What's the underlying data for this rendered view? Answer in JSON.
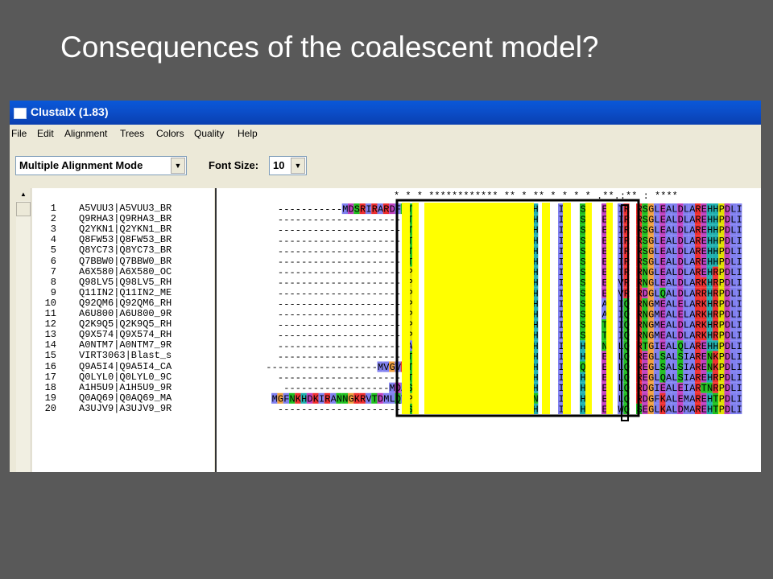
{
  "slide": {
    "title": "Consequences of the coalescent model?"
  },
  "window": {
    "title": "ClustalX (1.83)"
  },
  "menu": [
    "File",
    "Edit",
    "Alignment",
    "Trees",
    "Colors",
    "Quality",
    "Help"
  ],
  "toolbar": {
    "mode_value": "Multiple Alignment Mode",
    "font_size_label": "Font Size:",
    "font_size_value": "10"
  },
  "conservation_line": "* * * ************ ** * ** * * *  * .**.:** : ****",
  "sequences": [
    {
      "num": "1",
      "name": "A5VUU3|A5VUU3_BR",
      "seq": "-----------MDSRIRARDFSTS"
    },
    {
      "num": "2",
      "name": "Q9RHA3|Q9RHA3_BR",
      "seq": "----------------------TS"
    },
    {
      "num": "3",
      "name": "Q2YKN1|Q2YKN1_BR",
      "seq": "----------------------TS"
    },
    {
      "num": "4",
      "name": "Q8FW53|Q8FW53_BR",
      "seq": "----------------------TS"
    },
    {
      "num": "5",
      "name": "Q8YC73|Q8YC73_BR",
      "seq": "----------------------TS"
    },
    {
      "num": "6",
      "name": "Q7BBW0|Q7BBW0_BR",
      "seq": "----------------------TS"
    },
    {
      "num": "7",
      "name": "A6X580|A6X580_OC",
      "seq": "----------------------PS"
    },
    {
      "num": "8",
      "name": "Q98LV5|Q98LV5_RH",
      "seq": "----------------------PK"
    },
    {
      "num": "9",
      "name": "Q11IN2|Q11IN2_ME",
      "seq": "----------------------PS"
    },
    {
      "num": "10",
      "name": "Q92QM6|Q92QM6_RH",
      "seq": "----------------------PQ"
    },
    {
      "num": "11",
      "name": "A6U800|A6U800_9R",
      "seq": "----------------------PQ"
    },
    {
      "num": "12",
      "name": "Q2K9Q5|Q2K9Q5_RH",
      "seq": "----------------------PQ"
    },
    {
      "num": "13",
      "name": "Q9X574|Q9X574_RH",
      "seq": "----------------------PQ"
    },
    {
      "num": "14",
      "name": "A0NTM7|A0NTM7_9R",
      "seq": "----------------------AS"
    },
    {
      "num": "15",
      "name": "VIRT3063|Blast_s",
      "seq": "----------------------TS"
    },
    {
      "num": "16",
      "name": "Q9A5I4|Q9A5I4_CA",
      "seq": "-------------------MVGVRTK"
    },
    {
      "num": "17",
      "name": "Q0LYL0|Q0LYL0_9C",
      "seq": "----------------------TK"
    },
    {
      "num": "18",
      "name": "A1H5U9|A1H5U9_9R",
      "seq": "------------------MDASK"
    },
    {
      "num": "19",
      "name": "Q0AQ69|Q0AQ69_MA",
      "seq": "MGFNKHDKIRANNGKRVTDMLQVPK"
    },
    {
      "num": "20",
      "name": "A3UJV9|A3UJV9_9R",
      "seq": "----------------------SK"
    }
  ],
  "right_columns": [
    [
      "H",
      "I",
      "S",
      "E",
      "IR",
      "RSGLEALDLAREHHPDLI"
    ],
    [
      "H",
      "I",
      "S",
      "E",
      "IR",
      "RSGLEALDLAREHHPDLI"
    ],
    [
      "H",
      "I",
      "S",
      "E",
      "IR",
      "RSGLEALDLAREHHPDLI"
    ],
    [
      "H",
      "I",
      "S",
      "E",
      "IR",
      "RSGLEALDLAREHHPDLI"
    ],
    [
      "H",
      "I",
      "S",
      "E",
      "IR",
      "RSGLEALDLAREHHPDLI"
    ],
    [
      "H",
      "I",
      "S",
      "E",
      "IR",
      "RSGLEALDLAREHHPDLI"
    ],
    [
      "H",
      "I",
      "S",
      "E",
      "IR",
      "RNGLEALDLAREHRPDLI"
    ],
    [
      "H",
      "I",
      "S",
      "E",
      "VR",
      "RNGLEALDLARKHRPDLI"
    ],
    [
      "H",
      "I",
      "S",
      "E",
      "VR",
      "RDGLQALDLARRHRPDLI"
    ],
    [
      "H",
      "I",
      "S",
      "A",
      "IQ",
      "RNGMEALELARKHRPDLI"
    ],
    [
      "H",
      "I",
      "S",
      "A",
      "IQ",
      "RNGMEALELARKHRPDLI"
    ],
    [
      "H",
      "I",
      "S",
      "T",
      "IQ",
      "RNGMEALDLARKHRPDLI"
    ],
    [
      "H",
      "I",
      "S",
      "T",
      "IQ",
      "RNGMEALDLARKHRPDLI"
    ],
    [
      "H",
      "I",
      "H",
      "N",
      "LQ",
      "RTGIEALQLAREHHPDLI"
    ],
    [
      "H",
      "I",
      "H",
      "E",
      "LQ",
      "REGLSALSIARENKPDLI"
    ],
    [
      "H",
      "I",
      "Q",
      "E",
      "LQ",
      "REGLSALSIARENKPDLI"
    ],
    [
      "H",
      "I",
      "H",
      "E",
      "LQ",
      "REGLQALSIAREHRPDLI"
    ],
    [
      "H",
      "I",
      "H",
      "E",
      "LQ",
      "RDGIEALEIARTNRPDLI"
    ],
    [
      "N",
      "I",
      "H",
      "E",
      "LQ",
      "RDGFKALEMAREHTPDLI"
    ],
    [
      "H",
      "I",
      "H",
      "E",
      "WQ",
      "SEGLKALDMAREHTPDLI"
    ]
  ],
  "colors": {
    "highlight": "#ffff00",
    "hydrophobic": "#8080f0",
    "charged_pos": "#ef3030",
    "charged_neg": "#c040c0",
    "polar": "#20c020",
    "glycine": "#f0a040",
    "proline": "#e0e000",
    "aromatic": "#20b0b0"
  }
}
